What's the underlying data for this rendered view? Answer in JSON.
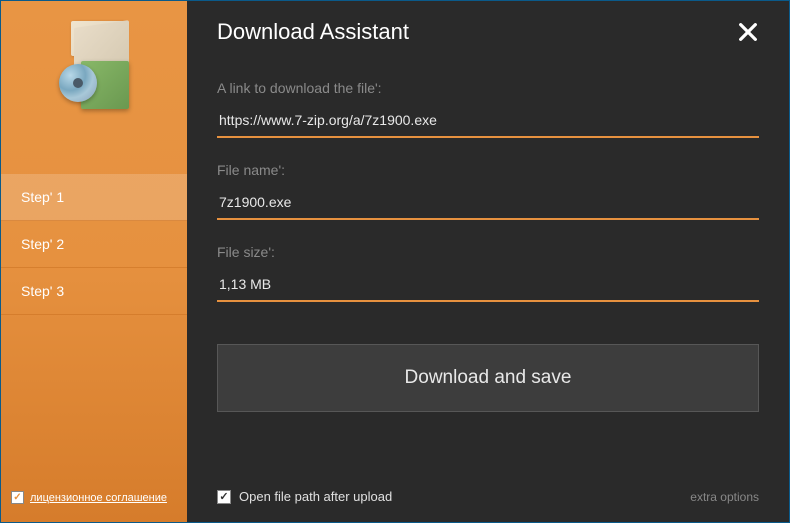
{
  "header": {
    "title": "Download Assistant"
  },
  "sidebar": {
    "steps": [
      {
        "label": "Step' 1",
        "active": true
      },
      {
        "label": "Step' 2",
        "active": false
      },
      {
        "label": "Step' 3",
        "active": false
      }
    ],
    "license": {
      "checked": true,
      "label": "лицензионное соглашение"
    }
  },
  "form": {
    "link": {
      "label": "A link to download the file':",
      "value": "https://www.7-zip.org/a/7z1900.exe"
    },
    "filename": {
      "label": "File name':",
      "value": "7z1900.exe"
    },
    "filesize": {
      "label": "File size':",
      "value": "1,13 MB"
    },
    "download_button": "Download and save"
  },
  "footer": {
    "open_path": {
      "checked": true,
      "label": "Open file path after upload"
    },
    "extra_options": "extra options"
  },
  "colors": {
    "accent": "#e6913f",
    "background": "#2a2a2a"
  }
}
